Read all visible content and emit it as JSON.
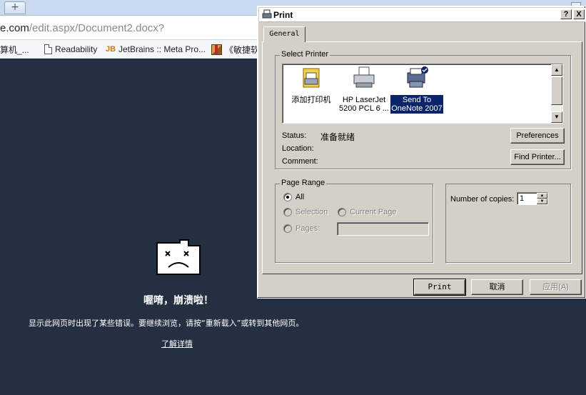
{
  "browser": {
    "new_tab_symbol": "+",
    "url_host": "e.com",
    "url_path": "/edit.aspx/Document2.docx?",
    "bookmarks": [
      {
        "label": "算机_...",
        "icon": "folder-icon"
      },
      {
        "label": "Readability",
        "icon": "page-icon"
      },
      {
        "label": "JetBrains :: Meta Pro...",
        "icon": "jetbrains-icon"
      },
      {
        "label": "《敏捷软",
        "icon": "box-icon"
      }
    ]
  },
  "crash_page": {
    "title": "喔唷，崩溃啦！",
    "message": "显示此网页时出现了某些错误。要继续浏览，请按“重新载入”或转到其他网页。",
    "link": "了解详情"
  },
  "print_dialog": {
    "title": "Print",
    "help_btn": "?",
    "close_btn": "X",
    "tab": "General",
    "select_printer_label": "Select Printer",
    "printers": [
      {
        "line1": "添加打印机",
        "line2": "",
        "selected": false,
        "icon": "add-printer-icon"
      },
      {
        "line1": "HP LaserJet",
        "line2": "5200 PCL 6 ...",
        "selected": false,
        "icon": "printer-icon"
      },
      {
        "line1": "Send To",
        "line2": "OneNote 2007",
        "selected": true,
        "icon": "default-printer-icon"
      }
    ],
    "status_label": "Status:",
    "status_value": "准备就绪",
    "location_label": "Location:",
    "comment_label": "Comment:",
    "preferences_btn": "Preferences",
    "find_printer_btn": "Find Printer...",
    "page_range_label": "Page Range",
    "range_all": "All",
    "range_selection": "Selection",
    "range_current": "Current Page",
    "range_pages": "Pages:",
    "copies_label": "Number of copies:",
    "copies_value": "1",
    "print_btn": "Print",
    "cancel_btn": "取消",
    "apply_btn": "应用(A)"
  }
}
